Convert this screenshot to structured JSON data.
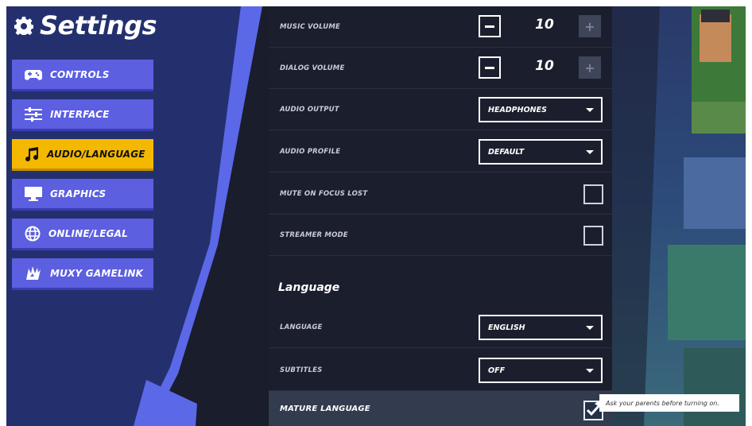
{
  "settings": {
    "title": "Settings",
    "nav": [
      {
        "label": "CONTROLS",
        "icon": "gamepad-icon",
        "active": false
      },
      {
        "label": "INTERFACE",
        "icon": "sliders-icon",
        "active": false
      },
      {
        "label": "AUDIO/LANGUAGE",
        "icon": "music-note-icon",
        "active": true
      },
      {
        "label": "GRAPHICS",
        "icon": "monitor-icon",
        "active": false
      },
      {
        "label": "ONLINE/LEGAL",
        "icon": "globe-icon",
        "active": false
      },
      {
        "label": "MUXY GAMELINK",
        "icon": "muxy-logo-icon",
        "active": false
      }
    ]
  },
  "audio": {
    "music_volume": {
      "label": "MUSIC VOLUME",
      "value": "10",
      "minus": "−",
      "plus": "+"
    },
    "dialog_volume": {
      "label": "DIALOG VOLUME",
      "value": "10",
      "minus": "−",
      "plus": "+"
    },
    "audio_output": {
      "label": "AUDIO OUTPUT",
      "value": "HEADPHONES"
    },
    "audio_profile": {
      "label": "AUDIO PROFILE",
      "value": "DEFAULT"
    },
    "mute_on_focus_lost": {
      "label": "MUTE ON FOCUS LOST",
      "checked": false
    },
    "streamer_mode": {
      "label": "STREAMER MODE",
      "checked": false
    }
  },
  "language": {
    "heading": "Language",
    "language": {
      "label": "LANGUAGE",
      "value": "ENGLISH"
    },
    "subtitles": {
      "label": "SUBTITLES",
      "value": "OFF"
    },
    "mature_language": {
      "label": "MATURE LANGUAGE",
      "checked": true
    }
  },
  "tooltip": {
    "text": "Ask your parents before turning on."
  },
  "colors": {
    "accent": "#f4b800",
    "nav_blue": "#5b5fe0",
    "panel_bg": "#1b1f2d",
    "sidebar_bg": "#23306a"
  }
}
